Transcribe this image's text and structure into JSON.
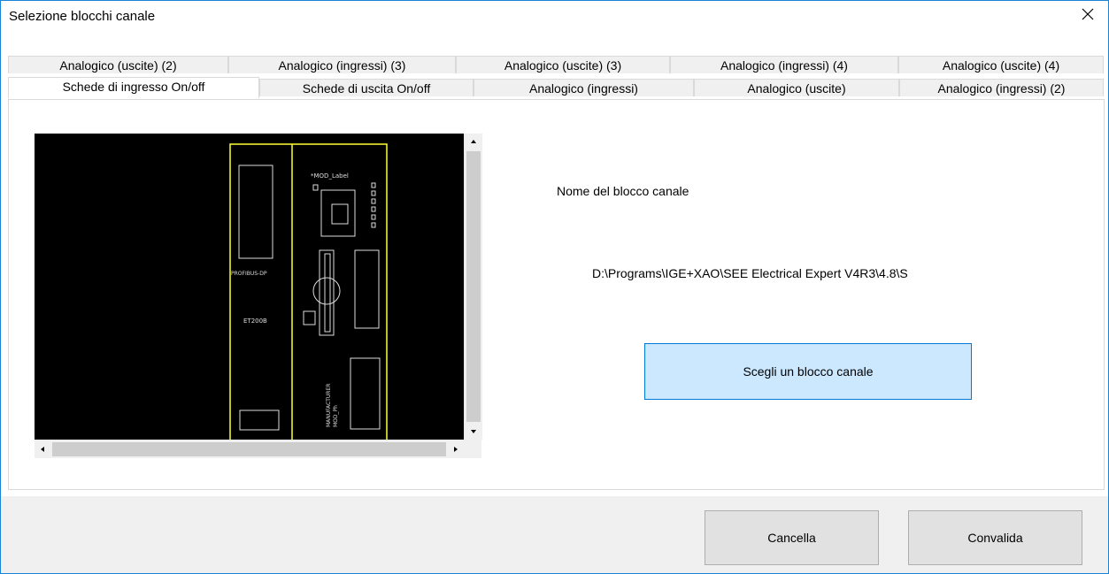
{
  "window": {
    "title": "Selezione blocchi canale"
  },
  "tabs": {
    "row_back": [
      "Analogico (uscite) (2)",
      "Analogico (ingressi) (3)",
      "Analogico (uscite) (3)",
      "Analogico (ingressi) (4)",
      "Analogico (uscite) (4)"
    ],
    "row_front": [
      "Schede di ingresso On/off",
      "Schede di uscita On/off",
      "Analogico (ingressi)",
      "Analogico (uscite)",
      "Analogico (ingressi) (2)"
    ],
    "selected": "Schede di ingresso On/off"
  },
  "preview": {
    "labels": {
      "mod_label": "*MOD_Label",
      "profibus": "PROFIBUS-DP",
      "et200": "ET200B",
      "manufacturer": "MANUFACTURER",
      "mod_ph": "MOD_Ph"
    }
  },
  "main": {
    "block_name_label": "Nome del blocco canale",
    "block_path": "D:\\Programs\\IGE+XAO\\SEE Electrical Expert V4R3\\4.8\\S",
    "choose_button": "Scegli un blocco canale"
  },
  "footer": {
    "cancel_button": "Cancella",
    "validate_button": "Convalida"
  },
  "colors": {
    "accent_border": "#0078d7",
    "choose_button_bg": "#cce8ff",
    "preview_bg": "#000000",
    "preview_frame": "#ffff33"
  }
}
